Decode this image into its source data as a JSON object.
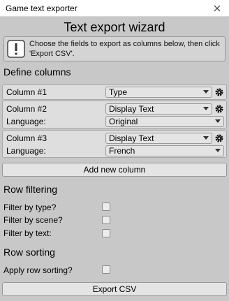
{
  "window": {
    "title": "Game text exporter"
  },
  "wizard": {
    "title": "Text export wizard",
    "help_text": "Choose the fields to export as columns below, then click 'Export CSV'."
  },
  "define_columns": {
    "heading": "Define columns",
    "columns": [
      {
        "label": "Column #1",
        "field": "Type"
      },
      {
        "label": "Column #2",
        "field": "Display Text",
        "language_label": "Language:",
        "language": "Original"
      },
      {
        "label": "Column #3",
        "field": "Display Text",
        "language_label": "Language:",
        "language": "French"
      }
    ],
    "add_button": "Add new column"
  },
  "row_filtering": {
    "heading": "Row filtering",
    "filters": [
      {
        "label": "Filter by type?",
        "checked": false
      },
      {
        "label": "Filter by scene?",
        "checked": false
      },
      {
        "label": "Filter by text:",
        "checked": false
      }
    ]
  },
  "row_sorting": {
    "heading": "Row sorting",
    "apply_label": "Apply row sorting?",
    "apply_checked": false
  },
  "export_button": "Export CSV",
  "colors": {
    "background": "#c8c8c8",
    "panel": "#dedede",
    "border": "#999999"
  }
}
